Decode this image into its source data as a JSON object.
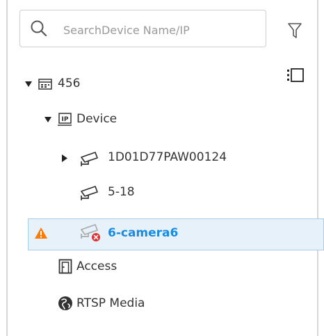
{
  "search": {
    "placeholder": "SearchDevice Name/IP",
    "value": ""
  },
  "tree": {
    "root": {
      "label": "456",
      "expanded": true,
      "icon": "server-icon"
    },
    "device_group": {
      "label": "Device",
      "expanded": true,
      "icon": "ip-device-icon"
    },
    "items": [
      {
        "label": "1D01D77PAW00124",
        "icon": "camera-icon",
        "collapsed": true
      },
      {
        "label": "5-18",
        "icon": "camera-icon"
      },
      {
        "label": "6-camera6",
        "icon": "camera-offline-icon",
        "status": "warning",
        "selected": true
      }
    ],
    "access": {
      "label": "Access",
      "icon": "door-icon"
    },
    "rtsp": {
      "label": "RTSP Media",
      "icon": "globe-icon"
    }
  },
  "colors": {
    "accent": "#1a8ce0",
    "warning": "#ff7a00",
    "error": "#e03030",
    "selection_bg": "#e6f1fa"
  }
}
